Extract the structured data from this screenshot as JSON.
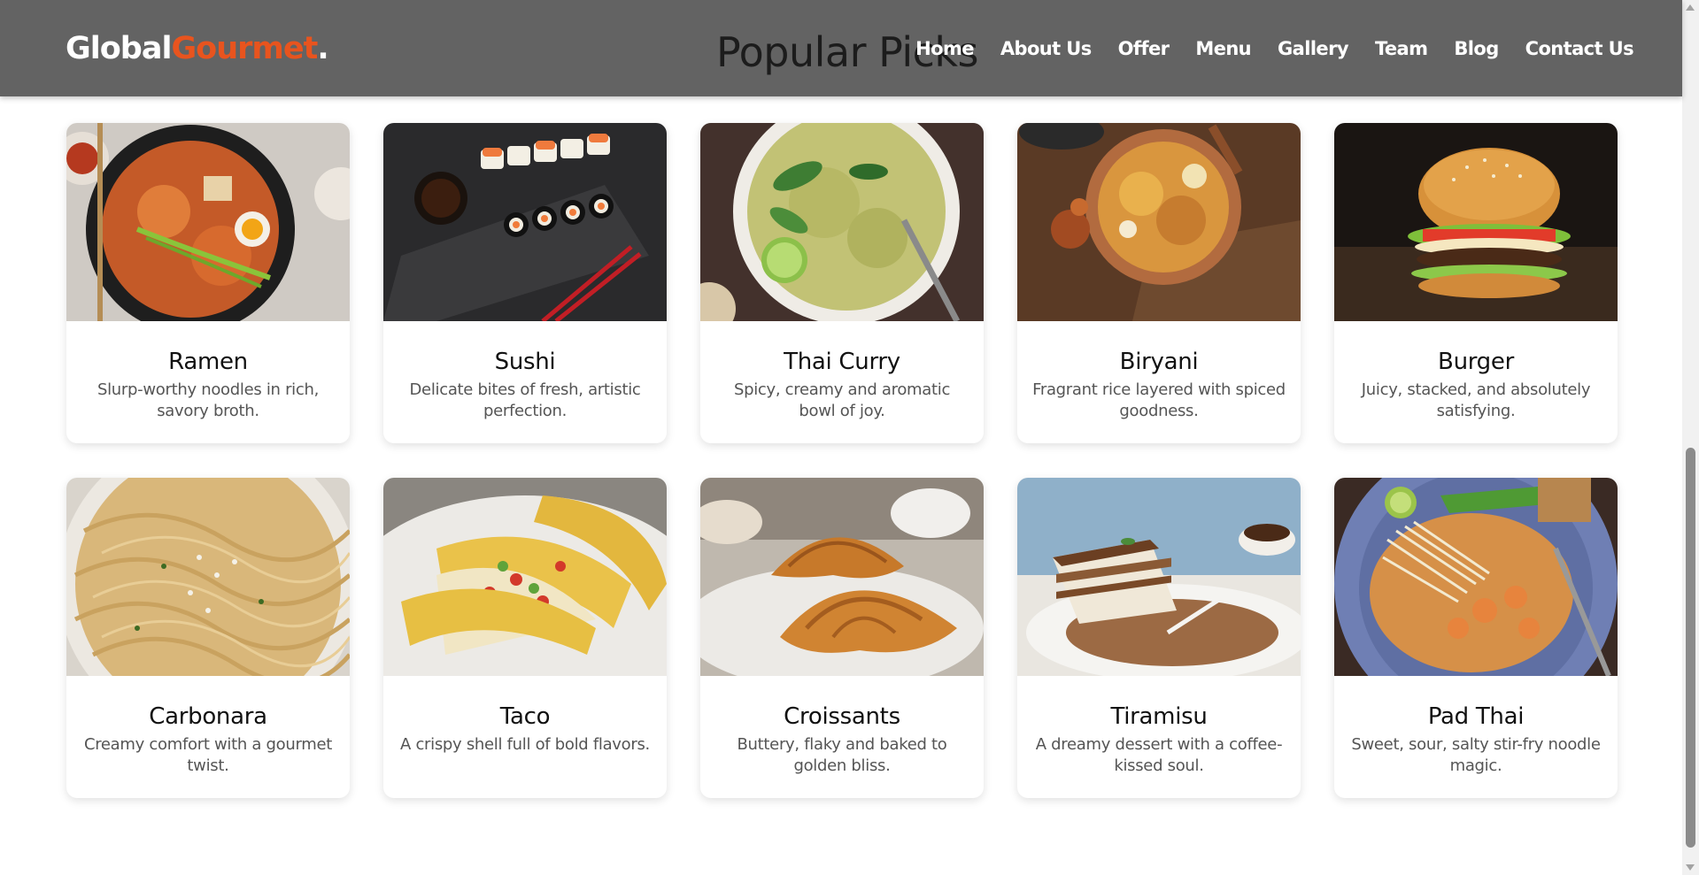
{
  "brand": {
    "name_main": "Global",
    "name_accent": "Gourmet",
    "name_dot": "."
  },
  "colors": {
    "navbar": "#636363",
    "accent": "#e8541e"
  },
  "section_title": "Popular Picks",
  "nav": [
    "Home",
    "About Us",
    "Offer",
    "Menu",
    "Gallery",
    "Team",
    "Blog",
    "Contact Us"
  ],
  "dishes": [
    {
      "name": "Ramen",
      "desc": "Slurp-worthy noodles in rich, savory broth.",
      "image": "ramen-image"
    },
    {
      "name": "Sushi",
      "desc": "Delicate bites of fresh, artistic perfection.",
      "image": "sushi-image"
    },
    {
      "name": "Thai Curry",
      "desc": "Spicy, creamy and aromatic bowl of joy.",
      "image": "thai-curry-image"
    },
    {
      "name": "Biryani",
      "desc": "Fragrant rice layered with spiced goodness.",
      "image": "biryani-image"
    },
    {
      "name": "Burger",
      "desc": "Juicy, stacked, and absolutely satisfying.",
      "image": "burger-image"
    },
    {
      "name": "Carbonara",
      "desc": "Creamy comfort with a gourmet twist.",
      "image": "carbonara-image"
    },
    {
      "name": "Taco",
      "desc": "A crispy shell full of bold flavors.",
      "image": "taco-image"
    },
    {
      "name": "Croissants",
      "desc": "Buttery, flaky and baked to golden bliss.",
      "image": "croissants-image"
    },
    {
      "name": "Tiramisu",
      "desc": "A dreamy dessert with a coffee-kissed soul.",
      "image": "tiramisu-image"
    },
    {
      "name": "Pad Thai",
      "desc": "Sweet, sour, salty stir-fry noodle magic.",
      "image": "pad-thai-image"
    }
  ]
}
